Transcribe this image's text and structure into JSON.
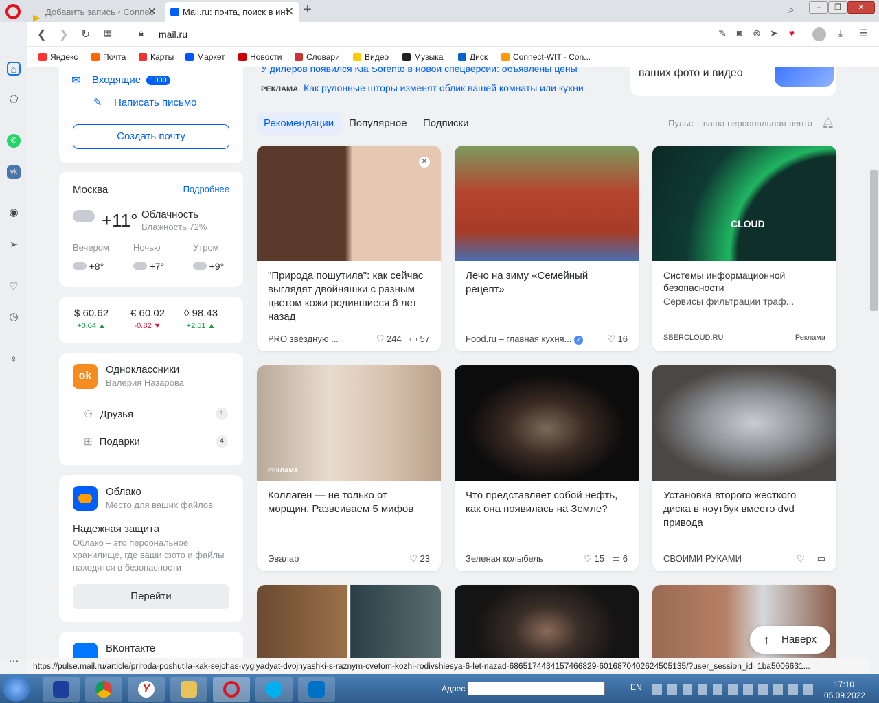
{
  "tabs": [
    {
      "label": "Добавить запись ‹ Connec"
    },
    {
      "label": "Mail.ru: почта, поиск в инт"
    }
  ],
  "address": {
    "url": "mail.ru"
  },
  "bookmarks": [
    {
      "label": "Яндекс",
      "color": "#f33"
    },
    {
      "label": "Почта",
      "color": "#f60"
    },
    {
      "label": "Карты",
      "color": "#e33"
    },
    {
      "label": "Маркет",
      "color": "#05f"
    },
    {
      "label": "Новости",
      "color": "#c00"
    },
    {
      "label": "Словари",
      "color": "#c33"
    },
    {
      "label": "Видео",
      "color": "#fc0"
    },
    {
      "label": "Музыка",
      "color": "#222"
    },
    {
      "label": "Диск",
      "color": "#06c"
    },
    {
      "label": "Connect-WIT - Con...",
      "color": "#f90"
    }
  ],
  "mail": {
    "inbox_label": "Входящие",
    "inbox_count": "1000",
    "compose_label": "Написать письмо",
    "create_label": "Создать почту"
  },
  "weather": {
    "city": "Москва",
    "more": "Подробнее",
    "temp": "+11°",
    "condition": "Облачность",
    "humidity": "Влажность 72%",
    "forecast": [
      {
        "label": "Вечером",
        "temp": "+8°"
      },
      {
        "label": "Ночью",
        "temp": "+7°"
      },
      {
        "label": "Утром",
        "temp": "+9°"
      }
    ]
  },
  "rates": [
    {
      "symbol": "$",
      "value": "60.62",
      "delta": "+0.04 ▲",
      "up": true
    },
    {
      "symbol": "€",
      "value": "60.02",
      "delta": "-0.82 ▼",
      "up": false
    },
    {
      "symbol": "◊",
      "value": "98.43",
      "delta": "+2.51 ▲",
      "up": true
    }
  ],
  "ok": {
    "title": "Одноклассники",
    "user": "Валерия Назарова",
    "items": [
      {
        "label": "Друзья",
        "count": "1"
      },
      {
        "label": "Подарки",
        "count": "4"
      }
    ]
  },
  "cloud": {
    "title": "Облако",
    "subtitle": "Место для ваших файлов",
    "heading": "Надежная защита",
    "text": "Облако – это персональное хранилище, где ваши фото и файлы находятся в безопасности",
    "button": "Перейти"
  },
  "vk": {
    "title": "ВКонтакте"
  },
  "news_top": {
    "line1": "У дилеров появился Kia Sorento в новой спецверсии: объявлены цены",
    "ad_label": "РЕКЛАМА",
    "ad_text": "Как рулонные шторы изменят облик вашей комнаты или кухни",
    "promo": "ваших фото и видео"
  },
  "feed_tabs": [
    "Рекомендации",
    "Популярное",
    "Подписки"
  ],
  "pulse": "Пульс – ваша персональная лента",
  "cards": [
    {
      "title": "\"Природа пошутила\": как сейчас выглядят двойняшки с разным цветом кожи родившиеся 6 лет назад",
      "source": "PRO звёздную ...",
      "likes": "244",
      "comments": "57",
      "img": "#a47e64"
    },
    {
      "title": "Лечо на зиму «Семейный рецепт»",
      "source": "Food.ru – главная кухня...",
      "likes": "16",
      "comments": "",
      "img": "#b5452f"
    },
    {
      "title": "Системы информационной безопасности",
      "subtitle": "Сервисы фильтрации траф...",
      "source": "SBERCLOUD.RU",
      "ad": "Реклама",
      "img": "#0f2f2a",
      "img_text": "CLOUD"
    },
    {
      "title": "Коллаген — не только от морщин. Развеиваем 5 мифов",
      "source": "Эвалар",
      "likes": "23",
      "comments": "",
      "img": "#c9b8a6",
      "ad_badge": "РЕКЛАМА"
    },
    {
      "title": "Что представляет собой нефть, как она появилась на Земле?",
      "source": "Зеленая колыбель",
      "likes": "15",
      "comments": "6",
      "img": "#1b1a19"
    },
    {
      "title": "Установка второго жесткого диска в ноутбук вместо dvd привода",
      "source": "СВОИМИ РУКАМИ",
      "likes": "",
      "comments": "",
      "img": "#6d6c6a"
    }
  ],
  "up_button": "Наверх",
  "status_url": "https://pulse.mail.ru/article/priroda-poshutila-kak-sejchas-vyglyadyat-dvojnyashki-s-raznym-cvetom-kozhi-rodivshiesya-6-let-nazad-6865174434157466829-6016870402624505135/?user_session_id=1ba5006631...",
  "taskbar": {
    "address_label": "Адрес",
    "lang": "EN",
    "time": "17:10",
    "date": "05.09.2022"
  }
}
